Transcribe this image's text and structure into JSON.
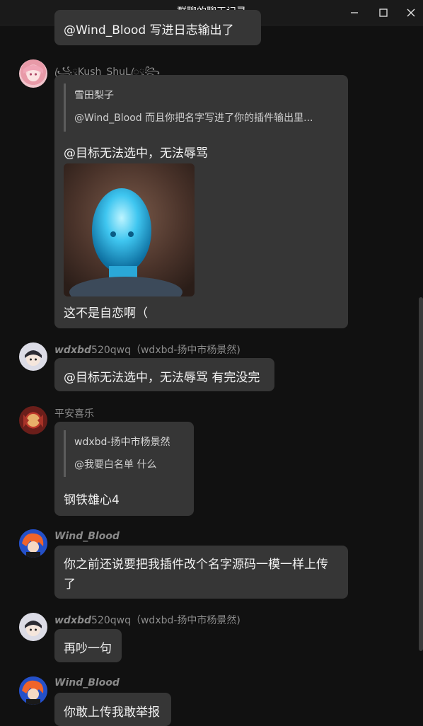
{
  "window": {
    "title": "群聊的聊天记录"
  },
  "messages": [
    {
      "bubble_text": "@Wind_Blood 写进日志输出了"
    },
    {
      "sender": "꧁ꦿ྄Kush_ShuLꦿ྄꧂",
      "quote": {
        "name": "雪田梨子",
        "text": "@Wind_Blood 而且你把名字写进了你的插件输出里..."
      },
      "text1": "@目标无法选中，无法辱骂",
      "text2": "这不是自恋啊（",
      "image_name": "blue glowing head photo"
    },
    {
      "sender_bold": "wdxbd",
      "sender_rest": "520qwq（wdxbd-扬中市杨景然)",
      "text": "@目标无法选中，无法辱骂 有完没完"
    },
    {
      "sender": "平安喜乐",
      "quote": {
        "name": "wdxbd-扬中市杨景然",
        "text": "@我要白名单 什么"
      },
      "text": "钢铁雄心4"
    },
    {
      "sender_bold": "Wind_Blood",
      "text_line1": "你之前还说要把我插件改个名字源码一模一样上传",
      "text_line2": "了"
    },
    {
      "sender_bold": "wdxbd",
      "sender_rest": "520qwq（wdxbd-扬中市杨景然)",
      "text": "再吵一句"
    },
    {
      "sender_bold": "Wind_Blood",
      "text": "你敢上传我敢举报"
    }
  ],
  "colors": {
    "background": "#111111",
    "bubble": "#363636",
    "name": "#8c8c8c"
  }
}
